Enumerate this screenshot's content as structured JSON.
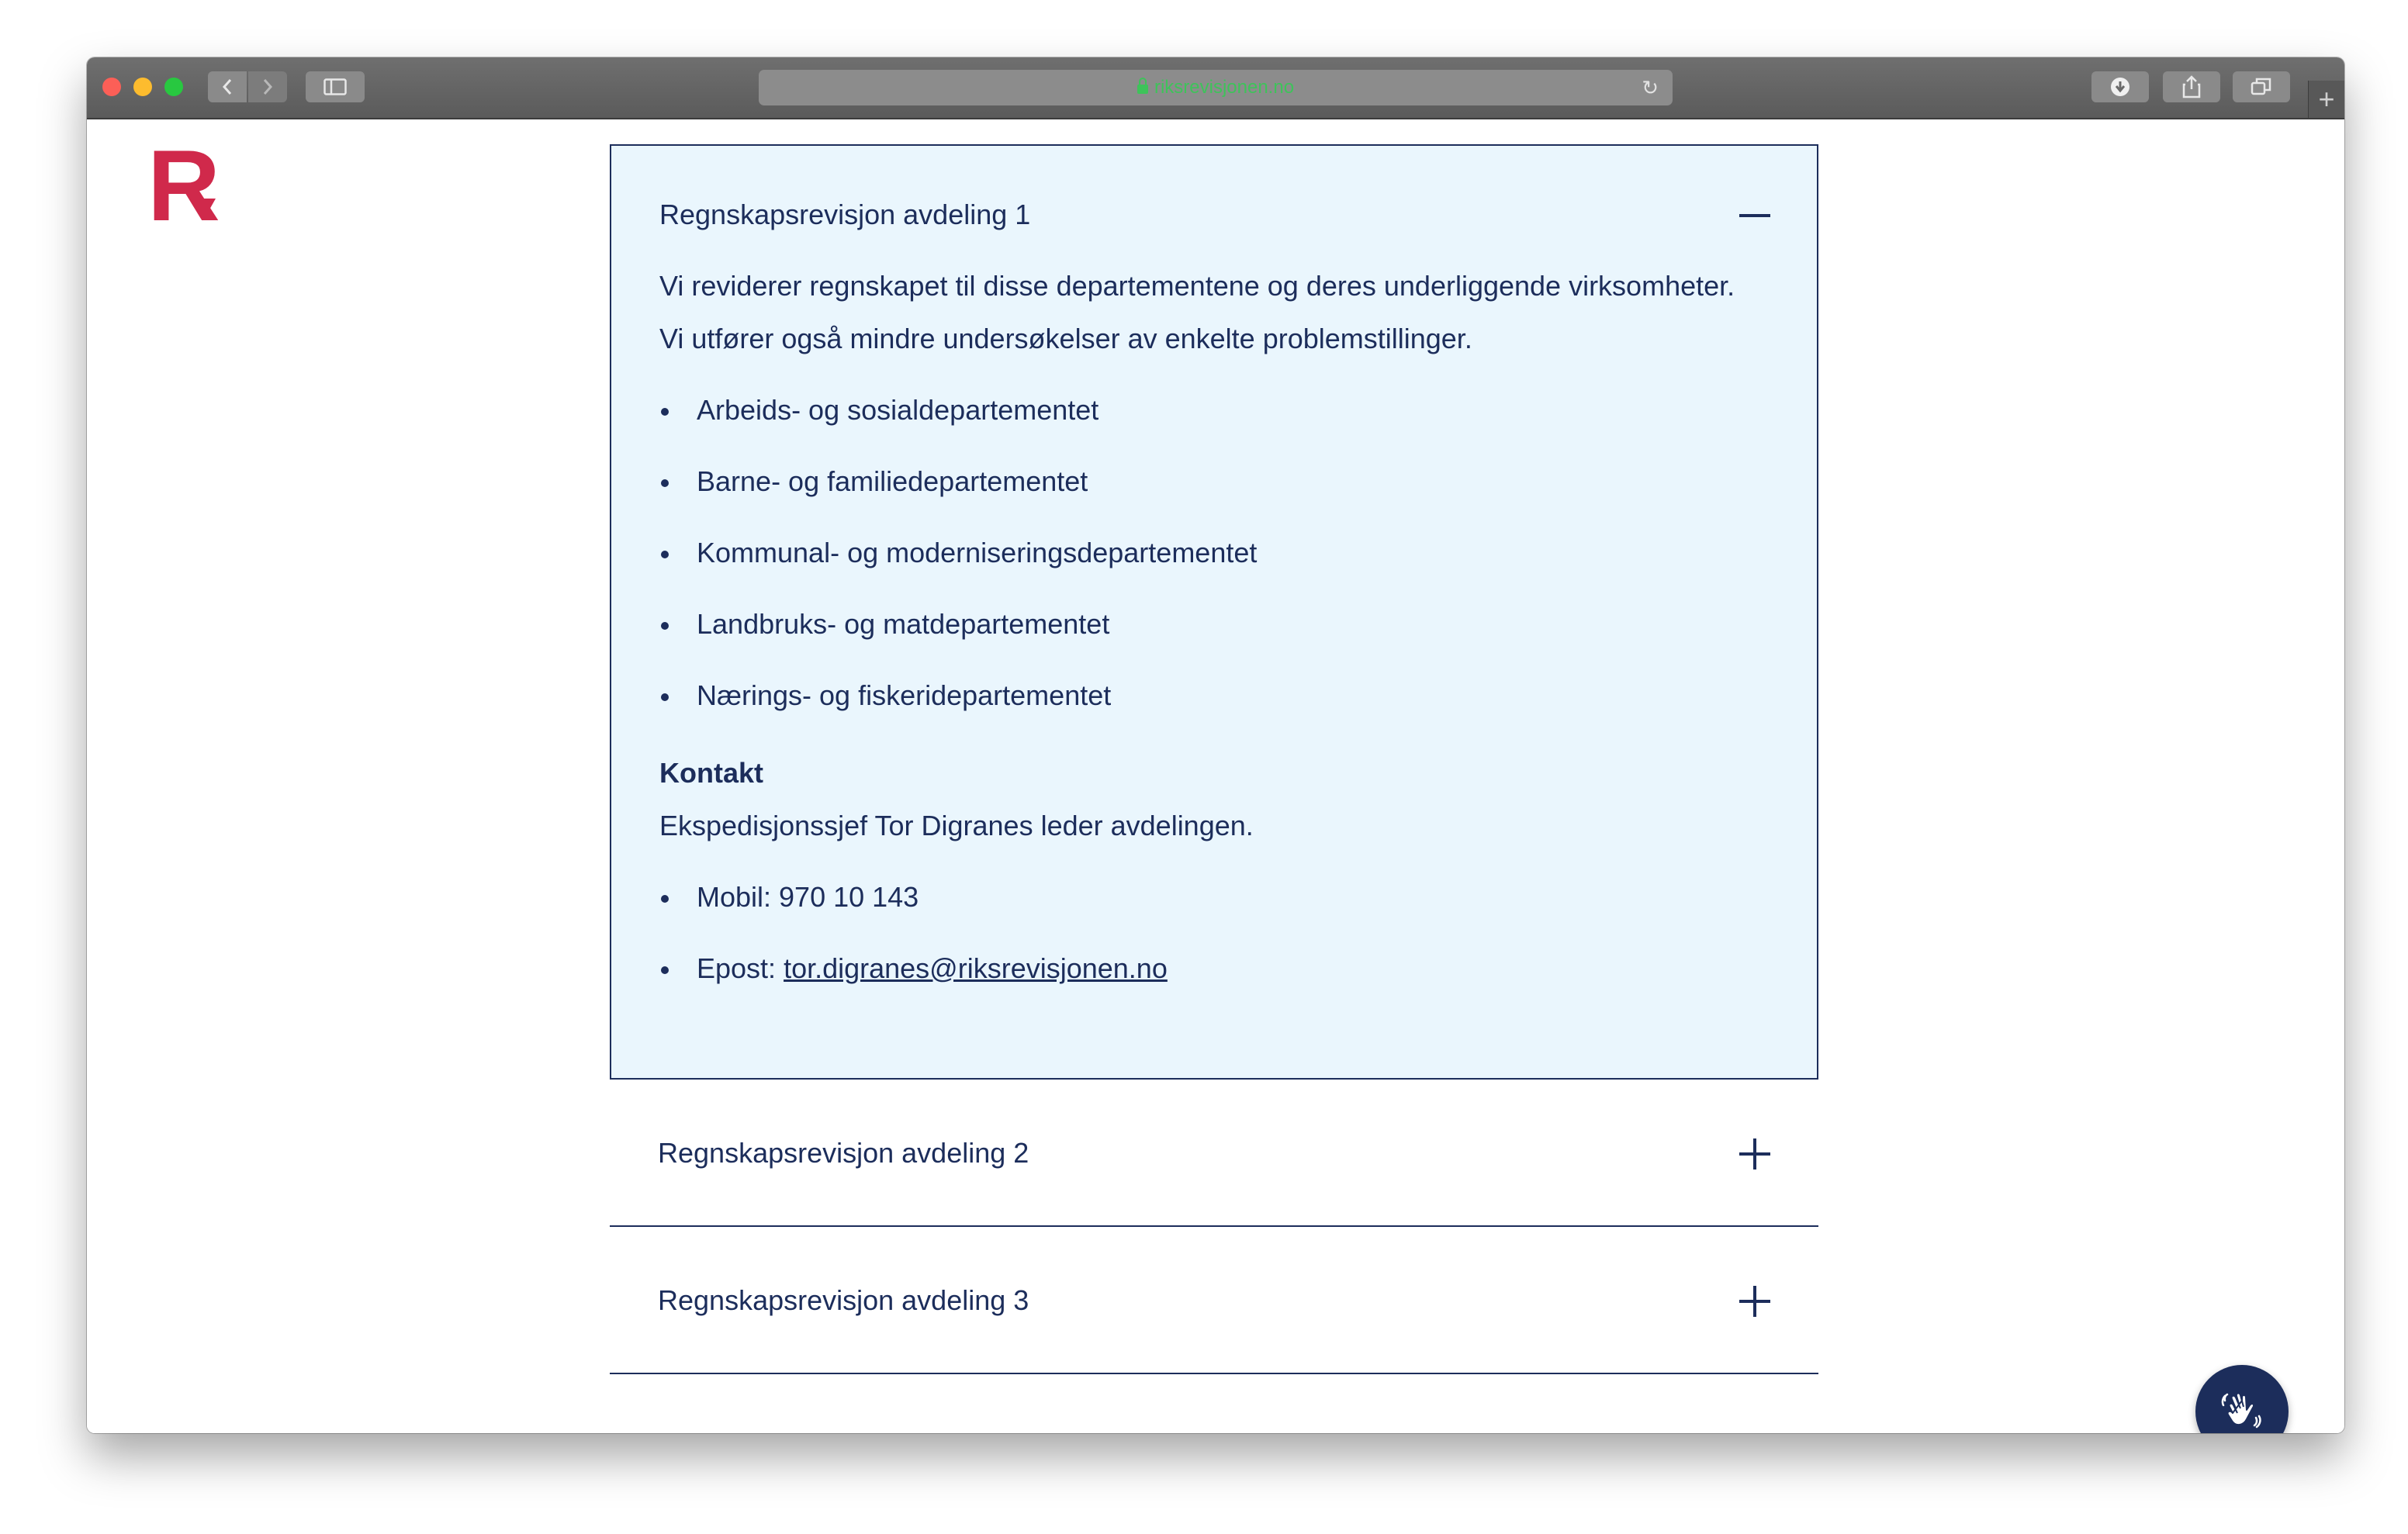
{
  "browser": {
    "url": "riksrevisjonen.no"
  },
  "site": {
    "logo_text": "R"
  },
  "accordion": {
    "open_item": {
      "title": "Regnskapsrevisjon avdeling 1",
      "intro_line1": "Vi reviderer regnskapet til disse departementene og deres underliggende virksomheter.",
      "intro_line2": "Vi utfører også mindre undersøkelser av enkelte problemstillinger.",
      "departments": [
        "Arbeids- og sosialdepartementet",
        "Barne- og familiedepartementet",
        "Kommunal- og moderniseringsdepartementet",
        "Landbruks- og matdepartementet",
        "Nærings- og fiskeridepartementet"
      ],
      "contact_heading": "Kontakt",
      "contact_text": "Ekspedisjonssjef Tor Digranes leder avdelingen.",
      "mobile_label": "Mobil: 970 10 143",
      "email_label": "Epost: ",
      "email": "tor.digranes@riksrevisjonen.no"
    },
    "closed_items": [
      {
        "title": "Regnskapsrevisjon avdeling 2"
      },
      {
        "title": "Regnskapsrevisjon avdeling 3"
      }
    ]
  },
  "colors": {
    "navy": "#1c2d5b",
    "panel_bg": "#eaf6fd",
    "brand_red": "#d0294b"
  },
  "icons": {
    "collapse": "minus-icon",
    "expand": "plus-icon",
    "chat": "waving-hand-icon"
  }
}
